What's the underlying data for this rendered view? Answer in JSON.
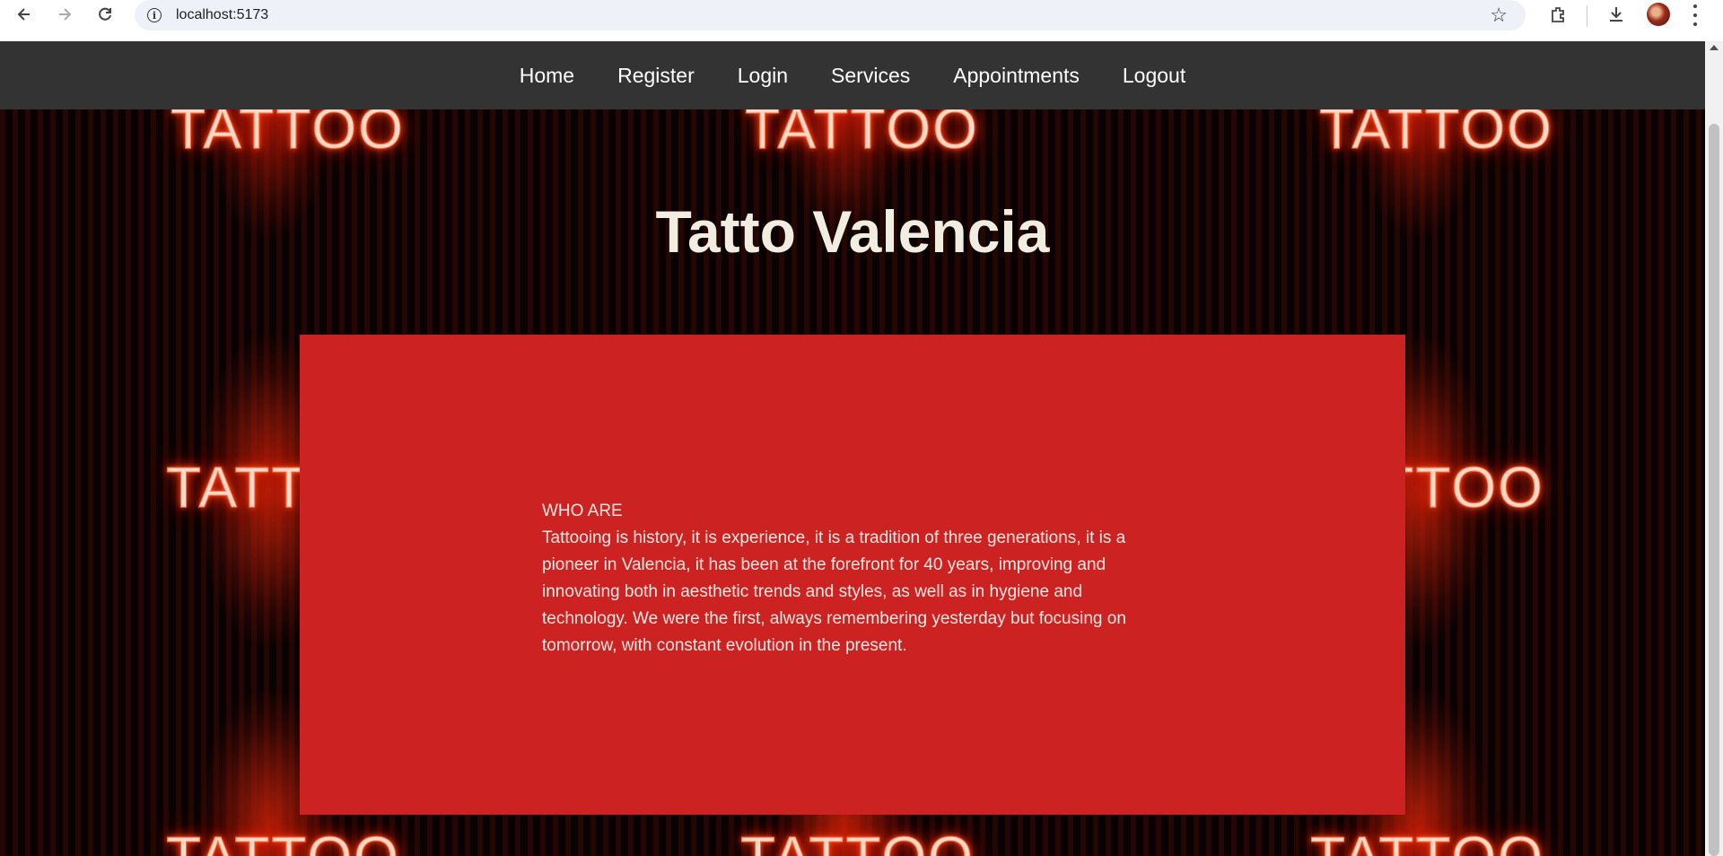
{
  "browser": {
    "url": "localhost:5173"
  },
  "nav": {
    "items": [
      {
        "label": "Home"
      },
      {
        "label": "Register"
      },
      {
        "label": "Login"
      },
      {
        "label": "Services"
      },
      {
        "label": "Appointments"
      },
      {
        "label": "Logout"
      }
    ]
  },
  "background": {
    "neon_text": "TATTOO"
  },
  "hero": {
    "title": "Tatto Valencia"
  },
  "about": {
    "heading": "WHO ARE",
    "body": "Tattooing is history, it is experience, it is a tradition of three generations, it is a pioneer in Valencia, it has been at the forefront for 40 years, improving and innovating both in aesthetic trends and styles, as well as in hygiene and technology. We were the first, always remembering yesterday but focusing on tomorrow, with constant evolution in the present."
  },
  "colors": {
    "navbar": "#333333",
    "card": "#cc2222",
    "title_text": "#f1ede0"
  }
}
